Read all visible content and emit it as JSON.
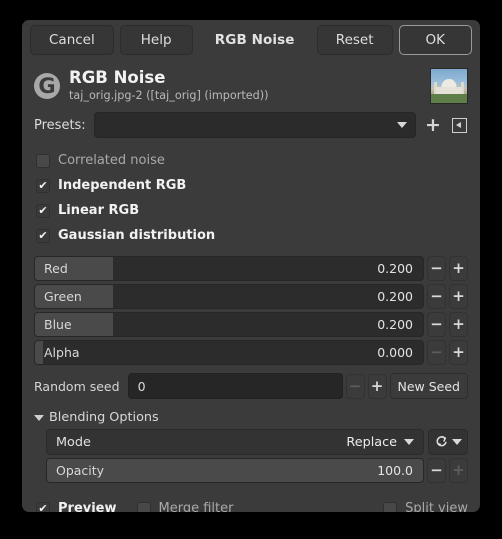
{
  "titlebar": {
    "cancel_label": "Cancel",
    "help_label": "Help",
    "title": "RGB Noise",
    "reset_label": "Reset",
    "ok_label": "OK"
  },
  "identity": {
    "logo_glyph": "G",
    "title": "RGB Noise",
    "subtitle": "taj_orig.jpg-2 ([taj_orig] (imported))"
  },
  "presets": {
    "label": "Presets:",
    "value": "",
    "placeholder": "",
    "add_glyph": "+",
    "menu_glyph": "◀"
  },
  "checkboxes": [
    {
      "label": "Correlated noise",
      "checked": false
    },
    {
      "label": "Independent RGB",
      "checked": true
    },
    {
      "label": "Linear RGB",
      "checked": true
    },
    {
      "label": "Gaussian distribution",
      "checked": true
    }
  ],
  "sliders": [
    {
      "name": "Red",
      "value": "0.200",
      "fill_percent": 20,
      "minus_disabled": false,
      "plus_disabled": false
    },
    {
      "name": "Green",
      "value": "0.200",
      "fill_percent": 20,
      "minus_disabled": false,
      "plus_disabled": false
    },
    {
      "name": "Blue",
      "value": "0.200",
      "fill_percent": 20,
      "minus_disabled": false,
      "plus_disabled": false
    },
    {
      "name": "Alpha",
      "value": "0.000",
      "fill_percent": 2,
      "minus_disabled": true,
      "plus_disabled": false
    }
  ],
  "random_seed": {
    "label": "Random seed",
    "value": "0",
    "minus_disabled": true,
    "plus_disabled": false,
    "new_seed_label": "New Seed"
  },
  "blending": {
    "section_label": "Blending Options",
    "expanded": true,
    "mode_label": "Mode",
    "mode_value": "Replace",
    "opacity_label": "Opacity",
    "opacity_value": "100.0",
    "opacity_fill_percent": 100,
    "opacity_minus_disabled": false,
    "opacity_plus_disabled": true
  },
  "footer": {
    "preview_label": "Preview",
    "preview_checked": true,
    "merge_filter_label": "Merge filter",
    "merge_filter_checked": false,
    "split_view_label": "Split view",
    "split_view_checked": false
  },
  "glyphs": {
    "check": "✔",
    "minus": "−",
    "plus": "+"
  }
}
